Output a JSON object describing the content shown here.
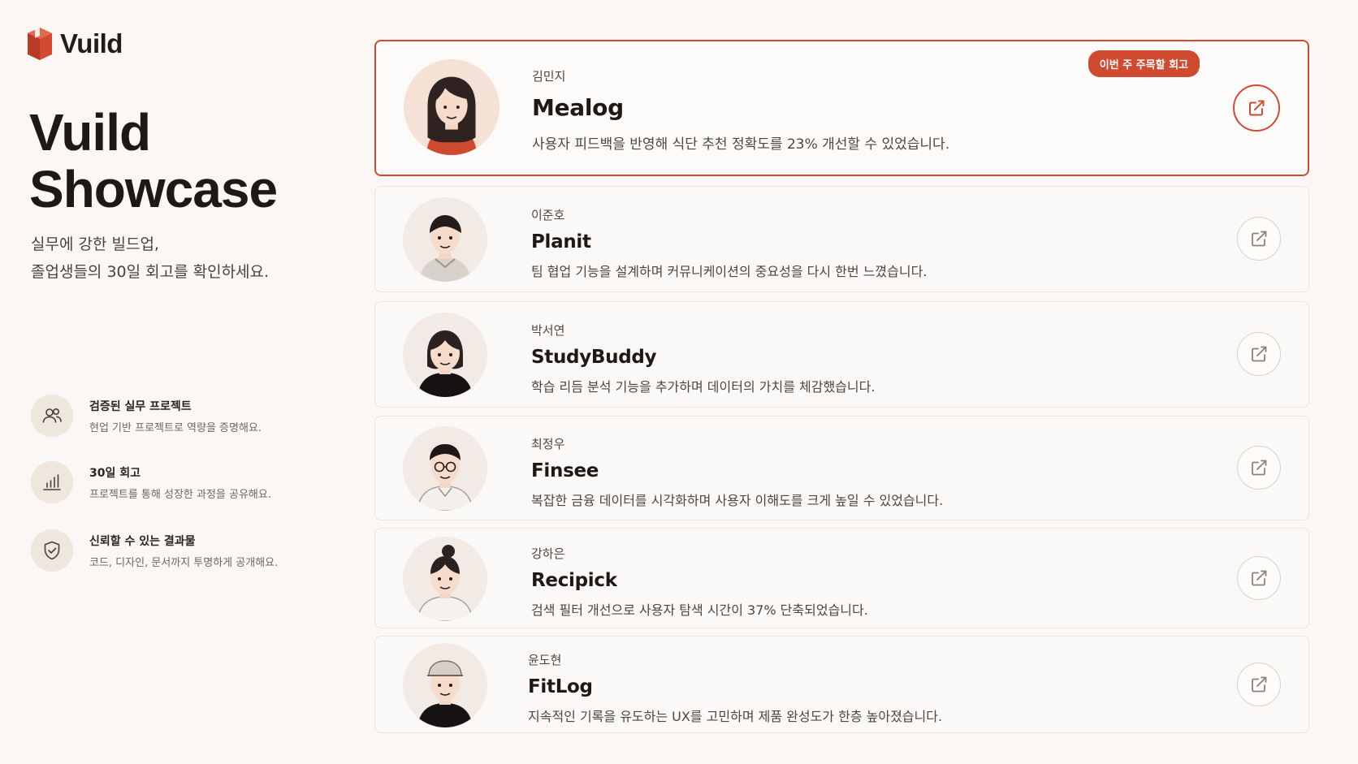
{
  "brand": {
    "name": "Vuild",
    "accent": "#d24a31"
  },
  "hero": {
    "title_line1": "Vuild",
    "title_line2": "Showcase",
    "subtitle_line1": "실무에 강한 빌드업,",
    "subtitle_line2": "졸업생들의 30일 회고를 확인하세요."
  },
  "features": [
    {
      "icon": "users-icon",
      "title": "검증된 실무 프로젝트",
      "desc": "현업 기반 프로젝트로 역량을 증명해요."
    },
    {
      "icon": "bar-chart-icon",
      "title": "30일 회고",
      "desc": "프로젝트를 통해 성장한 과정을 공유해요."
    },
    {
      "icon": "shield-check-icon",
      "title": "신뢰할 수 있는 결과물",
      "desc": "코드, 디자인, 문서까지 투명하게 공개해요."
    }
  ],
  "cards": [
    {
      "author": "김민지",
      "title": "Mealog",
      "desc": "사용자 피드백을 반영해 식단 추천 정확도를 23% 개선할 수 있었습니다.",
      "badge": "이번 주 주목할 회고",
      "featured": true
    },
    {
      "author": "이준호",
      "title": "Planit",
      "desc": "팀 협업 기능을 설계하며 커뮤니케이션의 중요성을 다시 한번 느꼈습니다."
    },
    {
      "author": "박서연",
      "title": "StudyBuddy",
      "desc": "학습 리듬 분석 기능을 추가하며 데이터의 가치를 체감했습니다."
    },
    {
      "author": "최정우",
      "title": "Finsee",
      "desc": "복잡한 금융 데이터를 시각화하며 사용자 이해도를 크게 높일 수 있었습니다."
    },
    {
      "author": "강하은",
      "title": "Recipick",
      "desc": "검색 필터 개선으로 사용자 탐색 시간이 37% 단축되었습니다."
    },
    {
      "author": "윤도현",
      "title": "FitLog",
      "desc": "지속적인 기록을 유도하는 UX를 고민하며 제품 완성도가 한층 높아졌습니다."
    }
  ]
}
